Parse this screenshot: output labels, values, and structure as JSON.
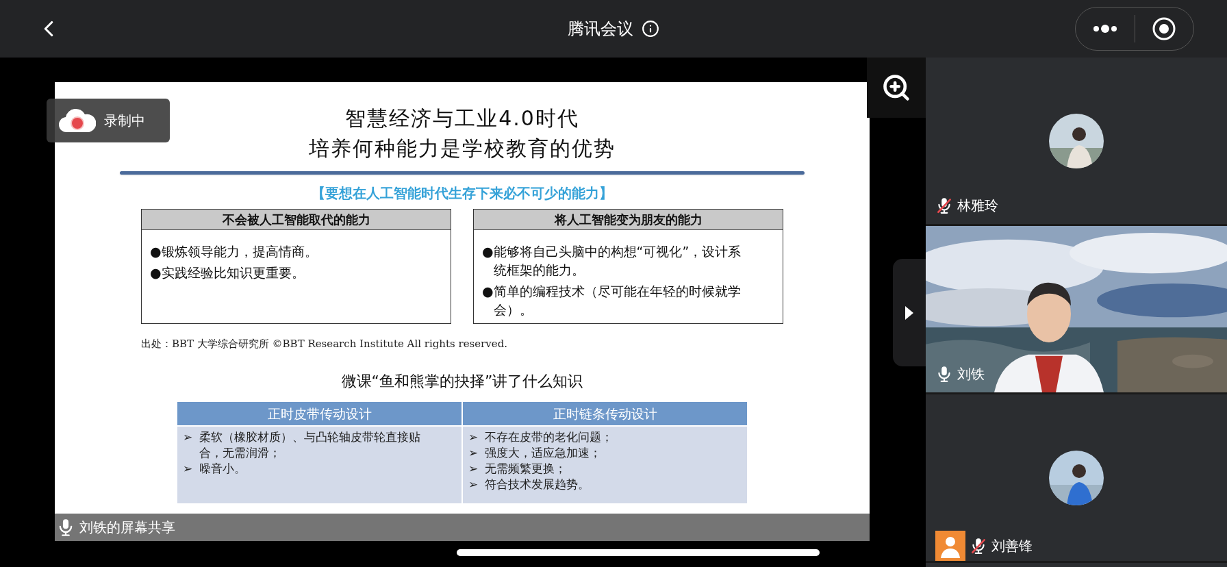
{
  "top_bar": {
    "title": "腾讯会议"
  },
  "recording": {
    "label": "录制中"
  },
  "slide": {
    "title_lines": [
      "智慧经济与工业4.0时代",
      "培养何种能力是学校教育的优势"
    ],
    "subtitle": "【要想在人工智能时代生存下来必不可少的能力】",
    "boxes": [
      {
        "heading": "不会被人工智能取代的能力",
        "bullet": "●",
        "items": [
          "锻炼领导能力，提高情商。",
          "实践经验比知识更重要。"
        ]
      },
      {
        "heading": "将人工智能变为朋友的能力",
        "bullet": "●",
        "items": [
          "能够将自己头脑中的构想“可视化”，设计系统框架的能力。",
          "简单的编程技术（尽可能在年轻的时候就学会）。"
        ]
      }
    ],
    "source": "出处：BBT 大学综合研究所 ©BBT Research Institute All rights reserved.",
    "question": "微课“鱼和熊掌的抉择”讲了什么知识",
    "table": {
      "bullet": "➢",
      "columns": [
        "正时皮带传动设计",
        "正时链条传动设计"
      ],
      "cells": [
        [
          "柔软（橡胶材质）、与凸轮轴皮带轮直接贴合，无需润滑；",
          "噪音小。"
        ],
        [
          "不存在皮带的老化问题；",
          "强度大，适应急加速；",
          "无需频繁更换；",
          "符合技术发展趋势。"
        ]
      ]
    }
  },
  "share_label": "刘铁的屏幕共享",
  "participants": [
    {
      "name": "林雅玲",
      "kind": "avatar",
      "muted": true,
      "person_badge": false
    },
    {
      "name": "刘铁",
      "kind": "video",
      "muted": false,
      "person_badge": false
    },
    {
      "name": "刘善锋",
      "kind": "avatar",
      "muted": true,
      "person_badge": true
    }
  ]
}
